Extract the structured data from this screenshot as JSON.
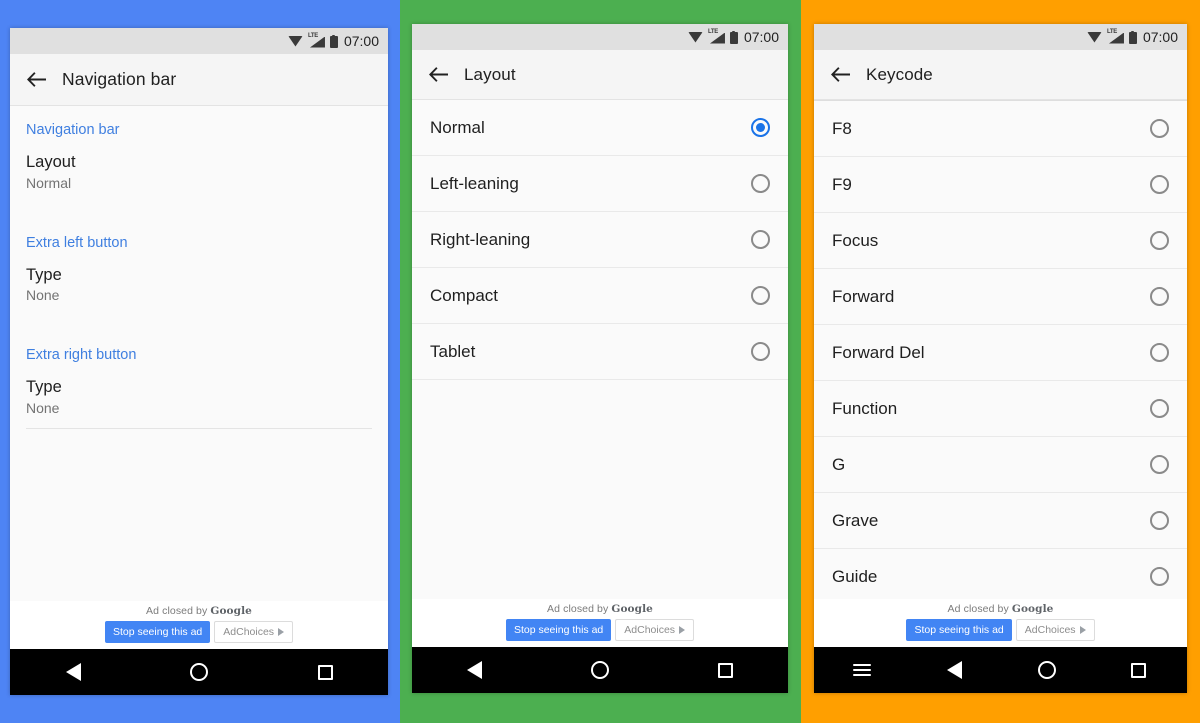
{
  "panels": [
    {
      "accent_color": "#4e84f4",
      "status_bar": {
        "clock": "07:00",
        "icons": [
          "wifi-icon",
          "lte-signal-icon",
          "battery-icon"
        ]
      },
      "app_bar": {
        "back_label": "back-arrow",
        "title": "Navigation bar"
      },
      "screen_type": "settings-list",
      "sections": [
        {
          "header": "Navigation bar",
          "items": [
            {
              "title": "Layout",
              "summary": "Normal"
            }
          ]
        },
        {
          "header": "Extra left button",
          "items": [
            {
              "title": "Type",
              "summary": "None"
            }
          ]
        },
        {
          "header": "Extra right button",
          "items": [
            {
              "title": "Type",
              "summary": "None"
            }
          ]
        }
      ],
      "ad": {
        "closed_text": "Ad closed by ",
        "brand": "Google",
        "stop_label": "Stop seeing this ad",
        "choices_label": "AdChoices"
      },
      "nav_bar": {
        "buttons": [
          "back",
          "home",
          "recents"
        ]
      }
    },
    {
      "accent_color": "#4caf50",
      "status_bar": {
        "clock": "07:00",
        "icons": [
          "wifi-icon",
          "lte-signal-icon",
          "battery-icon"
        ]
      },
      "app_bar": {
        "back_label": "back-arrow",
        "title": "Layout"
      },
      "screen_type": "radio-list",
      "options": [
        {
          "label": "Normal",
          "selected": true
        },
        {
          "label": "Left-leaning",
          "selected": false
        },
        {
          "label": "Right-leaning",
          "selected": false
        },
        {
          "label": "Compact",
          "selected": false
        },
        {
          "label": "Tablet",
          "selected": false
        }
      ],
      "ad": {
        "closed_text": "Ad closed by ",
        "brand": "Google",
        "stop_label": "Stop seeing this ad",
        "choices_label": "AdChoices"
      },
      "nav_bar": {
        "buttons": [
          "back",
          "home",
          "recents"
        ]
      }
    },
    {
      "accent_color": "#ff9f00",
      "status_bar": {
        "clock": "07:00",
        "icons": [
          "wifi-icon",
          "lte-signal-icon",
          "battery-icon"
        ]
      },
      "app_bar": {
        "back_label": "back-arrow",
        "title": "Keycode"
      },
      "screen_type": "radio-list",
      "options": [
        {
          "label": "F8",
          "selected": false
        },
        {
          "label": "F9",
          "selected": false
        },
        {
          "label": "Focus",
          "selected": false
        },
        {
          "label": "Forward",
          "selected": false
        },
        {
          "label": "Forward Del",
          "selected": false
        },
        {
          "label": "Function",
          "selected": false
        },
        {
          "label": "G",
          "selected": false
        },
        {
          "label": "Grave",
          "selected": false
        },
        {
          "label": "Guide",
          "selected": false
        }
      ],
      "ad": {
        "closed_text": "Ad closed by ",
        "brand": "Google",
        "stop_label": "Stop seeing this ad",
        "choices_label": "AdChoices"
      },
      "nav_bar": {
        "buttons": [
          "menu",
          "back",
          "home",
          "recents"
        ]
      }
    }
  ]
}
